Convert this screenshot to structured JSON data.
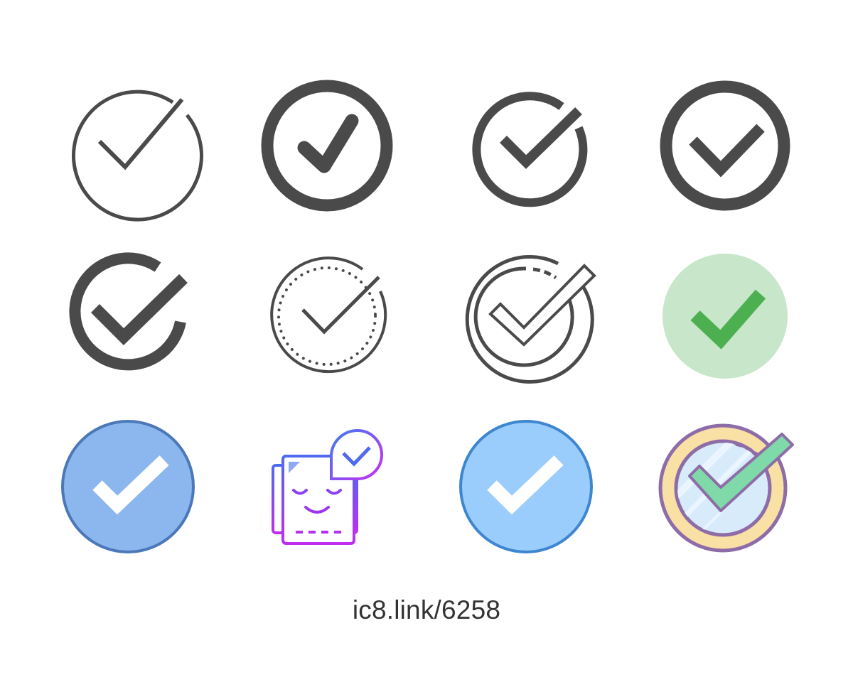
{
  "caption": "ic8.link/6258",
  "colors": {
    "dark_gray": "#4a4a4a",
    "green_bg": "#c8e6c9",
    "green_check": "#4caf50",
    "blue_fill_1": "#8cb6ee",
    "blue_stroke_1": "#4a78b8",
    "blue_fill_2": "#9acdfb",
    "blue_stroke_2": "#3f86d0",
    "gradient_start": "#3d7cf0",
    "gradient_end": "#c830f0",
    "gold": "#f9e0a4",
    "purple_stroke": "#8e6ca8",
    "mint_check": "#7fd9a8",
    "glass": "#d7ebfb"
  },
  "icons": [
    {
      "name": "circle-check-thin-icon"
    },
    {
      "name": "circle-check-bold-icon"
    },
    {
      "name": "circle-check-breaking-icon"
    },
    {
      "name": "circle-check-thick-icon"
    },
    {
      "name": "circle-check-open-icon"
    },
    {
      "name": "circle-check-dotted-icon"
    },
    {
      "name": "circle-check-double-ring-icon"
    },
    {
      "name": "circle-check-green-icon"
    },
    {
      "name": "circle-check-blue-icon"
    },
    {
      "name": "gradient-book-check-icon"
    },
    {
      "name": "circle-check-light-blue-icon"
    },
    {
      "name": "color-glass-check-icon"
    }
  ]
}
